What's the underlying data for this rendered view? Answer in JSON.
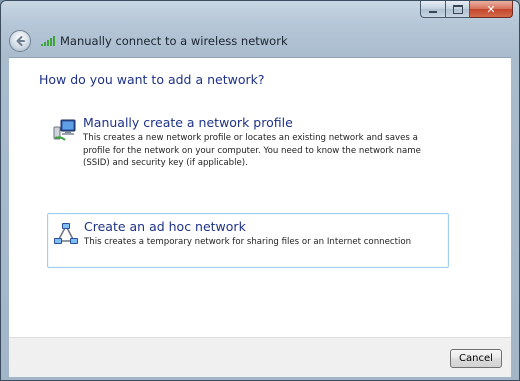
{
  "window": {
    "title": "Manually connect to a wireless network",
    "caption_buttons": {
      "minimize_icon": "minimize-icon",
      "maximize_icon": "maximize-icon",
      "close_icon": "close-icon",
      "close_glyph": "✕"
    }
  },
  "header": {
    "back_icon": "back-arrow-icon",
    "network_icon": "wireless-signal-icon"
  },
  "main": {
    "question": "How do you want to add a network?",
    "options": [
      {
        "title": "Manually create a network profile",
        "description": "This creates a new network profile or locates an existing network and saves a profile for the network on your computer. You need to know the network name (SSID) and security key (if applicable).",
        "icon": "network-profile-icon",
        "highlighted": false
      },
      {
        "title": "Create an ad hoc network",
        "description": "This creates a temporary network for sharing files or an Internet connection",
        "icon": "ad-hoc-network-icon",
        "highlighted": true
      }
    ]
  },
  "footer": {
    "cancel_label": "Cancel"
  },
  "colors": {
    "heading_blue": "#1e3287",
    "highlight_border": "#9fd2ea",
    "signal_green": "#3aa33a"
  }
}
